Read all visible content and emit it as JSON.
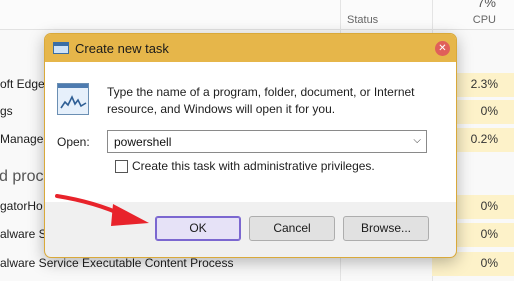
{
  "task_manager": {
    "cpu_percent_header": "7%",
    "columns": {
      "status": "Status",
      "cpu": "CPU"
    },
    "rows": [
      {
        "name": "oft Edge",
        "cpu": "2.3%"
      },
      {
        "name": "gs",
        "cpu": "0%"
      },
      {
        "name": "Manager",
        "cpu": "0.2%"
      },
      {
        "name": "gatorHo",
        "cpu": "0%"
      },
      {
        "name": "alware S",
        "cpu": "0%"
      },
      {
        "name": "alware Service Executable Content Process",
        "cpu": "0%"
      }
    ],
    "group_label": "d proc"
  },
  "dialog": {
    "title": "Create new task",
    "close_icon": "close-icon",
    "description": "Type the name of a program, folder, document, or Internet resource, and Windows will open it for you.",
    "open_label": "Open:",
    "open_value": "powershell",
    "admin_label": "Create this task with administrative privileges.",
    "admin_checked": false,
    "buttons": {
      "ok": "OK",
      "cancel": "Cancel",
      "browse": "Browse..."
    }
  },
  "annotation": {
    "arrow_color": "#e8232b"
  },
  "colors": {
    "title_bar": "#e6b64a",
    "ok_focus": "#7b67d0"
  }
}
